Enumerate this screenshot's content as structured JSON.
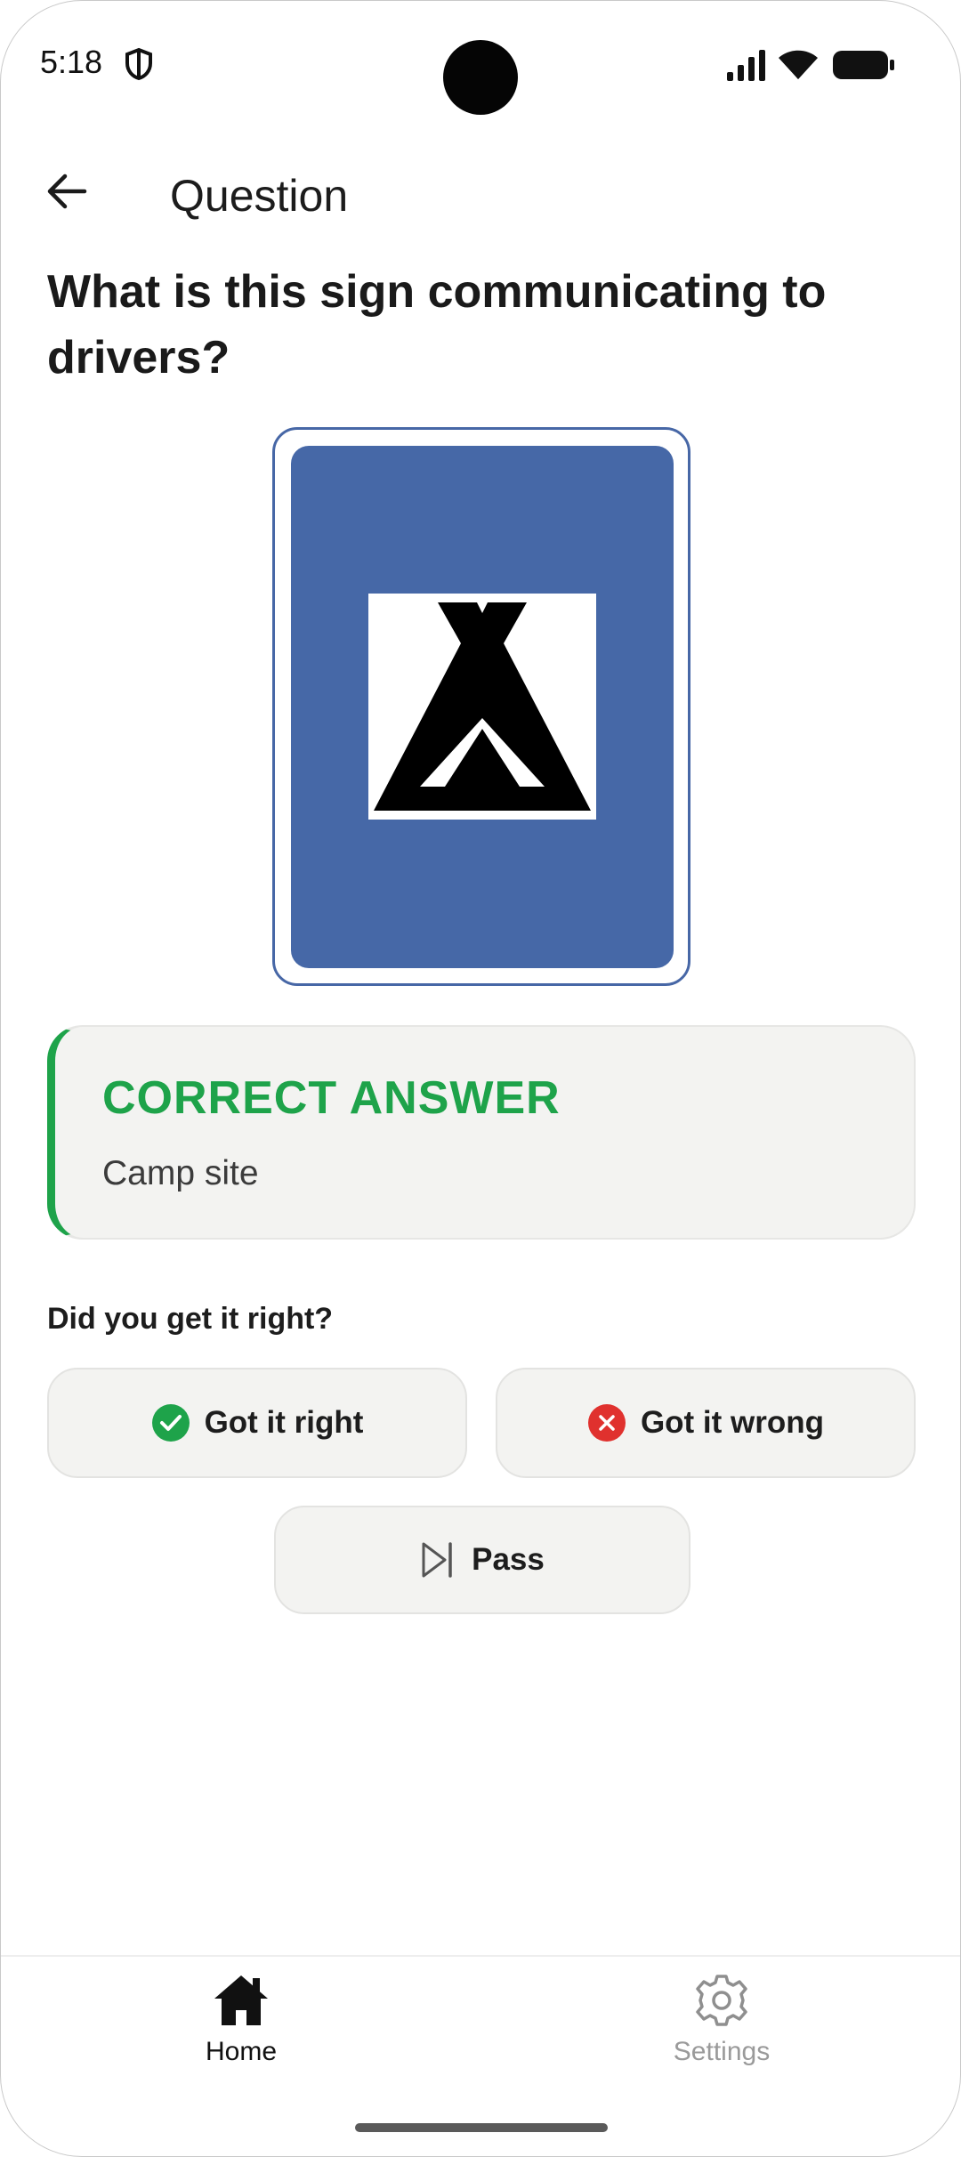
{
  "status_bar": {
    "time": "5:18",
    "icons": [
      "shield-icon",
      "signal-icon",
      "wifi-icon",
      "battery-icon"
    ]
  },
  "app_bar": {
    "back_icon": "arrow-left-icon",
    "title": "Question"
  },
  "question": {
    "text": "What is this sign communicating to drivers?",
    "sign": {
      "icon": "tent-icon",
      "background_color": "#4668a7",
      "border_color": "#4767a6"
    }
  },
  "answer": {
    "label": "CORRECT ANSWER",
    "text": "Camp site",
    "accent_color": "#1ea34a"
  },
  "self_check": {
    "prompt": "Did you get it right?",
    "right_label": "Got it right",
    "right_icon": "check-circle-icon",
    "right_color": "#1ea34a",
    "wrong_label": "Got it wrong",
    "wrong_icon": "x-circle-icon",
    "wrong_color": "#e0312e",
    "pass_label": "Pass",
    "pass_icon": "skip-next-icon"
  },
  "bottom_nav": {
    "items": [
      {
        "label": "Home",
        "icon": "home-icon",
        "active": true
      },
      {
        "label": "Settings",
        "icon": "gear-icon",
        "active": false
      }
    ]
  }
}
